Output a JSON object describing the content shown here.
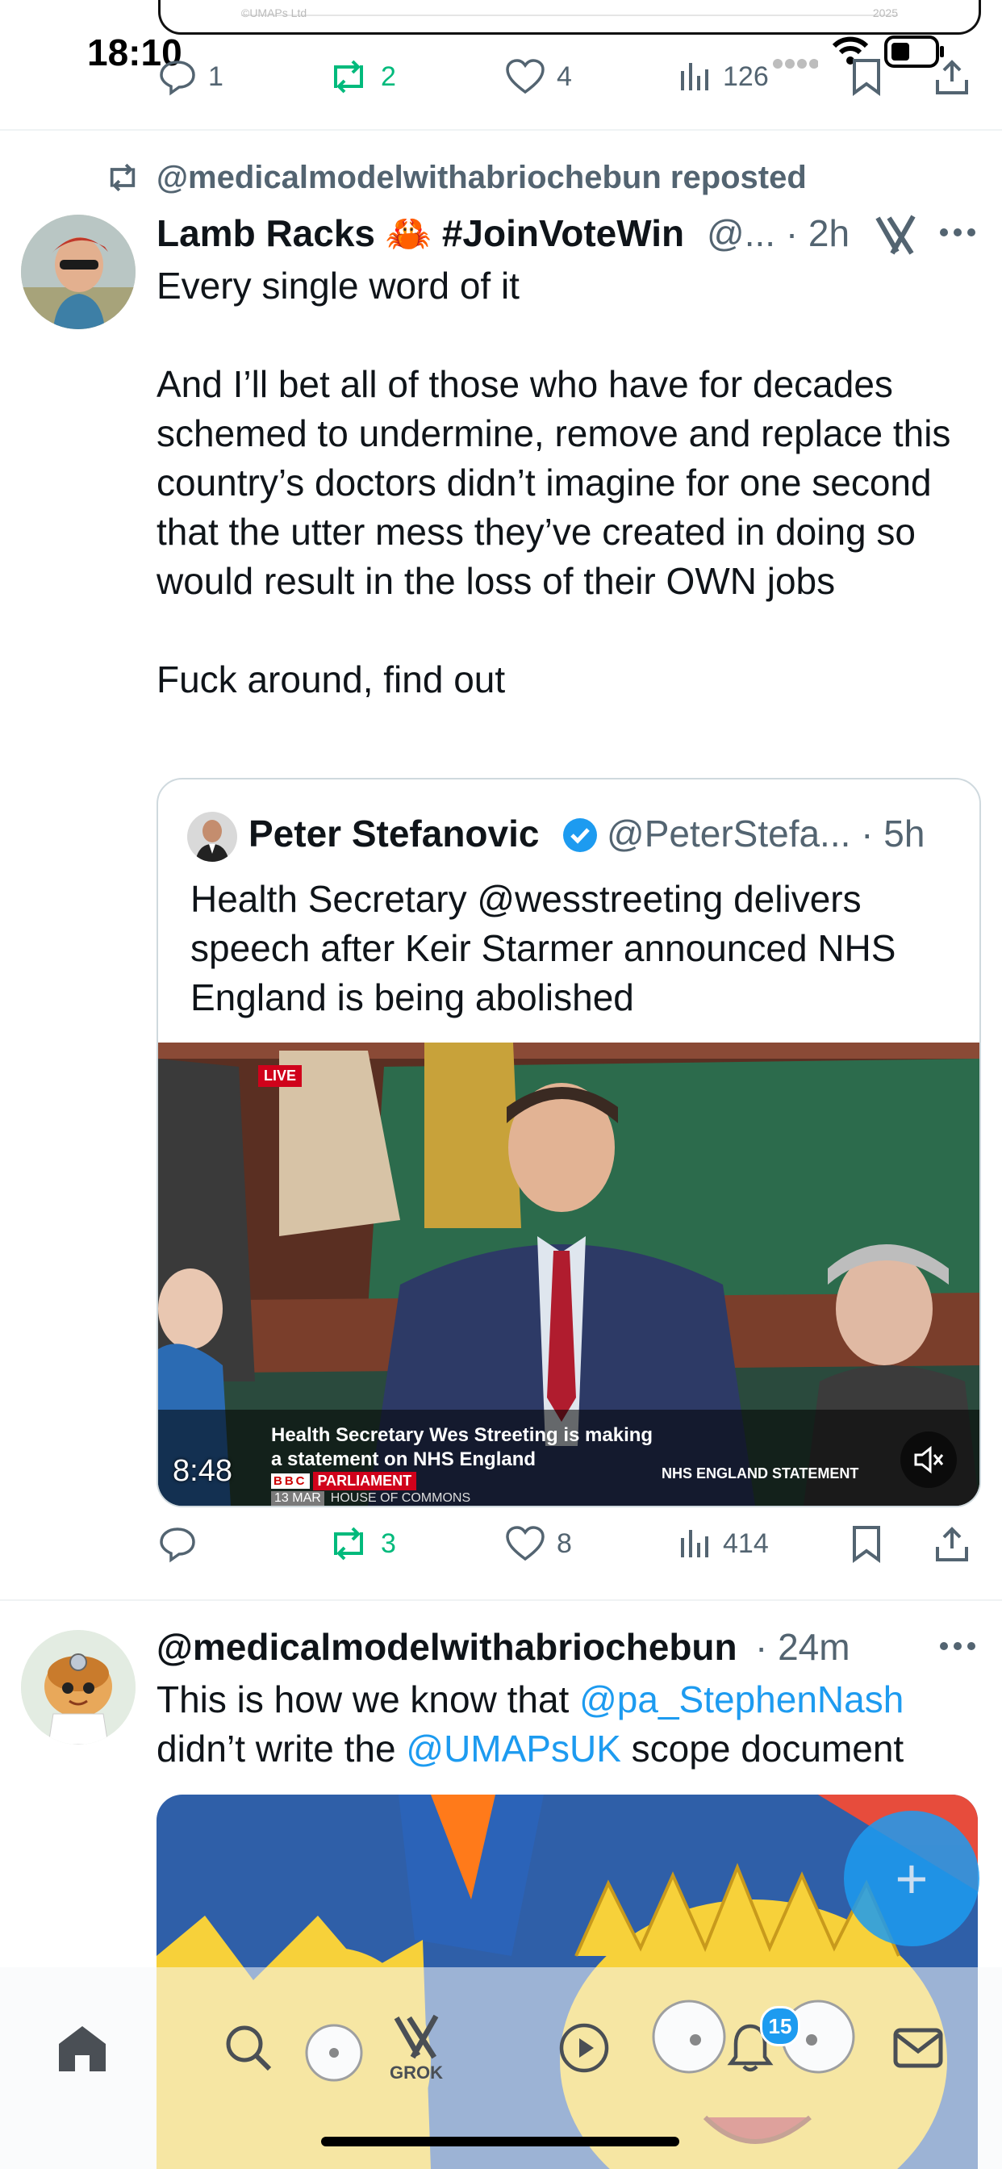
{
  "status_bar": {
    "time": "18:10",
    "icons": [
      "signal-dots-icon",
      "wifi-icon",
      "battery-icon"
    ]
  },
  "top_card": {
    "left_text": "©UMAPs Ltd",
    "right_text": "2025"
  },
  "prev_tweet_actions": {
    "replies": "1",
    "reposts": "2",
    "likes": "4",
    "views": "126"
  },
  "tweet1": {
    "repost_label": "@medicalmodelwithabriochebun reposted",
    "author_name": "Lamb Racks 🦀 #JoinVoteWin",
    "handle_time": "@... · 2h",
    "body": "Every single word of it\n\nAnd I’ll bet all of those who have for decades schemed to undermine, remove and replace this country’s doctors didn’t imagine for one second that the utter mess they’ve created in doing so would result in the loss of their OWN jobs\n\nFuck around, find out",
    "quote": {
      "author_name": "Peter Stefanovic",
      "handle_time": "@PeterStefa... · 5h",
      "text": "Health Secretary @wesstreeting delivers speech after Keir Starmer announced NHS England is being abolished",
      "video": {
        "live_badge": "LIVE",
        "caption_line1": "Health Secretary Wes Streeting is making",
        "caption_line2": "a statement on NHS England",
        "channel_logo": "BBC",
        "channel": "PARLIAMENT",
        "date": "13 MAR",
        "location": "HOUSE OF COMMONS",
        "ticker": "NHS ENGLAND STATEMENT",
        "duration": "8:48"
      }
    },
    "actions": {
      "replies": "",
      "reposts": "3",
      "likes": "8",
      "views": "414"
    }
  },
  "tweet2": {
    "author_name": "@medicalmodelwithabriochebun",
    "time": "· 24m",
    "text_part1": "This is how we know that ",
    "mention1": "@pa_StephenNash",
    "text_part2": "didn’t write the ",
    "mention2": "@UMAPsUK",
    "text_part3": " scope document"
  },
  "fab": {
    "label": "+"
  },
  "tabbar": {
    "items": [
      {
        "icon": "home-icon"
      },
      {
        "icon": "search-icon"
      },
      {
        "icon": "grok-icon",
        "label": "GROK"
      },
      {
        "icon": "video-play-icon"
      },
      {
        "icon": "bell-icon",
        "badge": "15"
      },
      {
        "icon": "mail-icon"
      }
    ]
  },
  "colors": {
    "accent": "#1d9bf0",
    "repost_green": "#00ba7c",
    "muted": "#536471",
    "verified": "#1d9bf0"
  }
}
